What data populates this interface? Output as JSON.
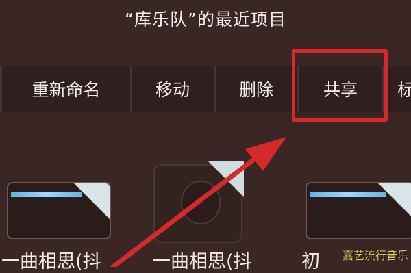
{
  "page_title": "“库乐队”的最近项目",
  "menu": {
    "items": [
      {
        "label": "重新命名",
        "name": "rename"
      },
      {
        "label": "移动",
        "name": "move"
      },
      {
        "label": "删除",
        "name": "delete"
      },
      {
        "label": "共享",
        "name": "share"
      },
      {
        "label": "标",
        "name": "tag-partial"
      }
    ]
  },
  "files": [
    {
      "name": "一曲相思(抖"
    },
    {
      "name": "一曲相思(抖"
    },
    {
      "name": "初"
    }
  ],
  "watermark": "嘉艺流行音乐",
  "annotation": {
    "color": "#d42a2a"
  }
}
